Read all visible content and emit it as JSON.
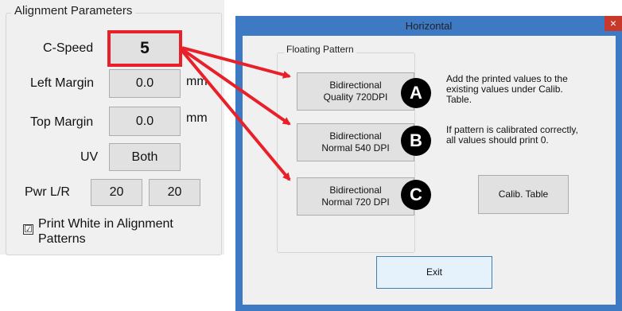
{
  "left_panel": {
    "group_title": "Alignment Parameters",
    "cspeed": {
      "label": "C-Speed",
      "value": "5"
    },
    "left_margin": {
      "label": "Left Margin",
      "value": "0.0",
      "unit": "mm"
    },
    "top_margin": {
      "label": "Top Margin",
      "value": "0.0",
      "unit": "mm"
    },
    "uv": {
      "label": "UV",
      "value": "Both"
    },
    "pwr": {
      "label": "Pwr L/R",
      "left": "20",
      "right": "20"
    },
    "print_white": {
      "label": "Print White in Alignment Patterns",
      "checked": true,
      "check_glyph": "☑"
    }
  },
  "dialog": {
    "title": "Horizontal",
    "close_glyph": "×",
    "group_title": "Floating Pattern",
    "buttons": [
      {
        "line1": "Bidirectional",
        "line2": "Quality 720DPI"
      },
      {
        "line1": "Bidirectional",
        "line2": "Normal 540 DPI"
      },
      {
        "line1": "Bidirectional",
        "line2": "Normal 720 DPI"
      }
    ],
    "info1_lines": [
      "Add the printed values to the",
      "existing values under Calib.",
      "Table."
    ],
    "info2_lines": [
      "If pattern is calibrated correctly,",
      "all values should print 0."
    ],
    "calib_button": "Calib. Table",
    "exit_button": "Exit"
  },
  "callouts": [
    "A",
    "B",
    "C"
  ],
  "colors": {
    "highlight": "#e8202a",
    "titlebar": "#3e79c4",
    "close": "#c7392a"
  }
}
